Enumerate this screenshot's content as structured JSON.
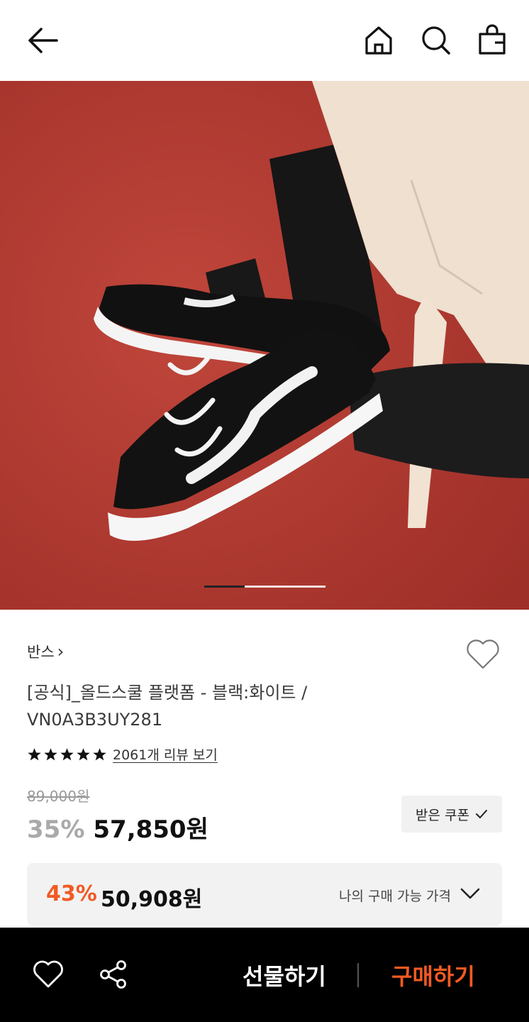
{
  "header": {
    "back_icon": "arrow-left-icon",
    "icons": [
      "home-icon",
      "search-icon",
      "shopping-bag-icon"
    ]
  },
  "gallery": {
    "current_page": 1,
    "total_pages": 3,
    "image_description_colors": {
      "background": "#b13a31"
    }
  },
  "product": {
    "brand": "반스",
    "brand_chevron": "›",
    "title": "[공식]_올드스쿨 플랫폼 - 블랙:화이트 / VN0A3B3UY281",
    "rating_stars": 5,
    "review_link": "2061개 리뷰 보기",
    "original_price": "89,000원",
    "discount_rate": "35%",
    "sale_price": "57,850원",
    "coupon_button": "받은 쿠폰",
    "my_price": {
      "discount_rate": "43%",
      "price": "50,908원",
      "label": "나의 구매 가능 가격"
    }
  },
  "bottom_bar": {
    "gift_label": "선물하기",
    "buy_label": "구매하기"
  },
  "colors": {
    "accent": "#f15a24",
    "bottom_bar": "#000000",
    "muted_text": "#a9a9a9"
  }
}
